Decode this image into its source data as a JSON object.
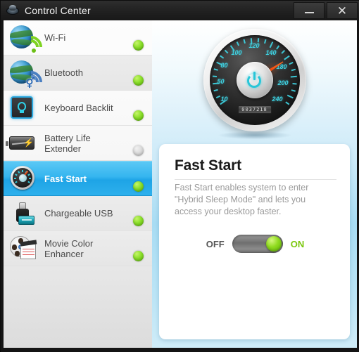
{
  "window": {
    "title": "Control Center",
    "app_icon": "control-center-disc-icon",
    "minimize_label": "–",
    "close_label": "✕"
  },
  "sidebar": {
    "items": [
      {
        "label": "Wi-Fi",
        "icon": "wifi-globe-icon",
        "status": "on",
        "selected": false
      },
      {
        "label": "Bluetooth",
        "icon": "bluetooth-globe-icon",
        "status": "on",
        "selected": false
      },
      {
        "label": "Keyboard Backlit",
        "icon": "keyboard-backlight-icon",
        "status": "on",
        "selected": false
      },
      {
        "label": "Battery Life Extender",
        "icon": "battery-icon",
        "status": "off",
        "selected": false
      },
      {
        "label": "Fast Start",
        "icon": "speedometer-icon",
        "status": "on",
        "selected": true
      },
      {
        "label": "Chargeable USB",
        "icon": "usb-battery-icon",
        "status": "on",
        "selected": false
      },
      {
        "label": "Movie Color Enhancer",
        "icon": "film-reel-icon",
        "status": "on",
        "selected": false
      }
    ]
  },
  "gauge": {
    "name": "speedometer-widget",
    "numbers": [
      "10",
      "50",
      "80",
      "100",
      "120",
      "140",
      "180",
      "200",
      "240"
    ],
    "odometer": "0037218",
    "needle_value": "140",
    "center_icon": "power-icon",
    "dial_color": "#3fd2e2",
    "needle_color": "#f0480c"
  },
  "panel": {
    "title": "Fast Start",
    "description": "Fast Start enables system to enter \"Hybrid Sleep Mode\" and lets you access your desktop faster.",
    "toggle": {
      "off_label": "OFF",
      "on_label": "ON",
      "state": "on",
      "on_color": "#7ac70c"
    }
  },
  "colors": {
    "accent": "#2eb0ec",
    "status_on": "#8ade2a",
    "status_off": "#dcdcdc",
    "titlebar": "#222222"
  }
}
